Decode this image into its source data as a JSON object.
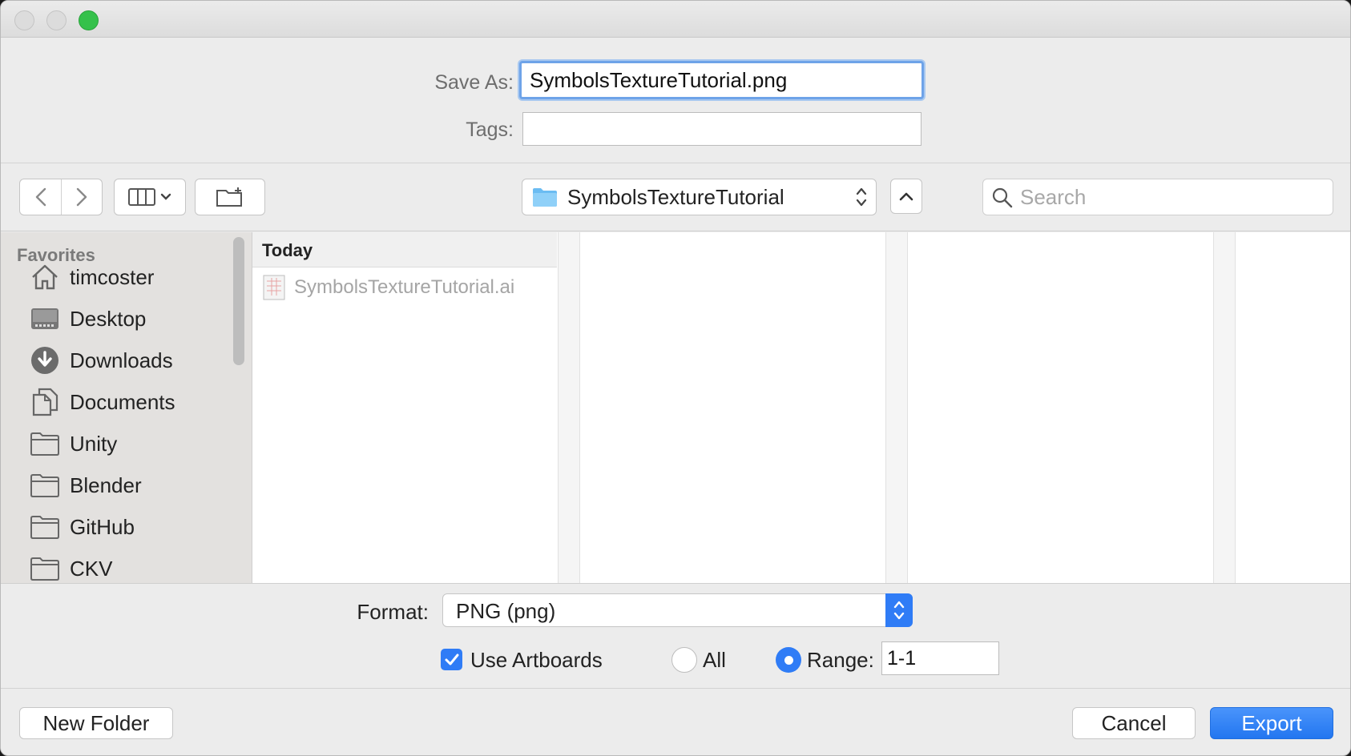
{
  "window": {
    "traffic_lights": [
      "close",
      "minimize",
      "maximize"
    ]
  },
  "name_section": {
    "save_as_label": "Save As:",
    "save_as_value": "SymbolsTextureTutorial.png",
    "tags_label": "Tags:",
    "tags_value": ""
  },
  "toolbar": {
    "back_icon": "chevron-left-icon",
    "forward_icon": "chevron-right-icon",
    "view_icon": "column-view-icon",
    "new_folder_icon": "folder-plus-icon",
    "path_folder": "SymbolsTextureTutorial",
    "search_placeholder": "Search"
  },
  "sidebar": {
    "heading": "Favorites",
    "items": [
      {
        "label": "timcoster",
        "icon": "home-icon"
      },
      {
        "label": "Desktop",
        "icon": "desktop-icon"
      },
      {
        "label": "Downloads",
        "icon": "downloads-icon"
      },
      {
        "label": "Documents",
        "icon": "documents-icon"
      },
      {
        "label": "Unity",
        "icon": "folder-icon"
      },
      {
        "label": "Blender",
        "icon": "folder-icon"
      },
      {
        "label": "GitHub",
        "icon": "folder-icon"
      },
      {
        "label": "CKV",
        "icon": "folder-icon"
      }
    ]
  },
  "browser": {
    "column_header": "Today",
    "files": [
      {
        "name": "SymbolsTextureTutorial.ai",
        "icon": "ai-file-icon"
      }
    ]
  },
  "options": {
    "format_label": "Format:",
    "format_value": "PNG (png)",
    "use_artboards_label": "Use Artboards",
    "use_artboards_checked": true,
    "all_label": "All",
    "range_label": "Range:",
    "range_value": "1-1",
    "selected_radio": "Range"
  },
  "buttons": {
    "new_folder": "New Folder",
    "cancel": "Cancel",
    "export": "Export"
  },
  "colors": {
    "accent": "#2f7cf6",
    "focus_ring": "#6ea3e8",
    "sidebar_bg": "#e3e1df",
    "window_bg": "#ececec"
  }
}
